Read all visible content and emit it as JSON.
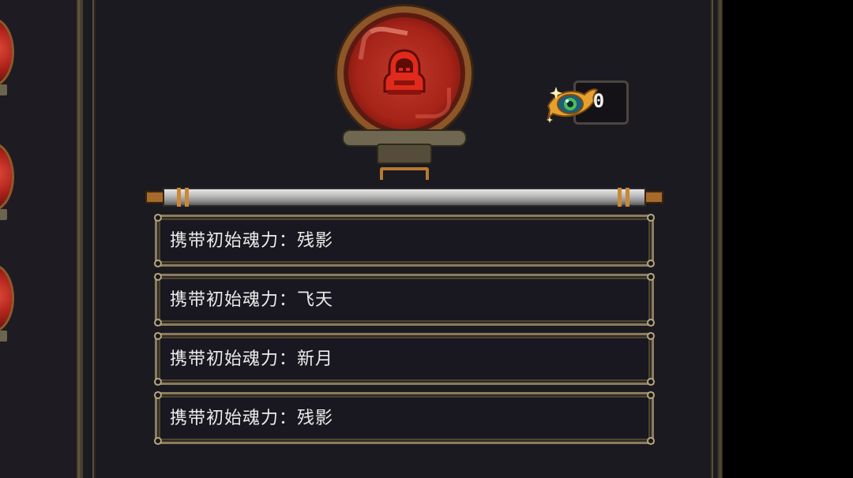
{
  "currency": {
    "count": "0",
    "icon": "ornate-eye-gem-icon"
  },
  "portrait": {
    "icon": "hooded-figure-icon",
    "orb_color": "#c0392b",
    "rim_color": "#8c5628"
  },
  "entries": [
    {
      "label": "携带初始魂力：残影"
    },
    {
      "label": "携带初始魂力：飞天"
    },
    {
      "label": "携带初始魂力：新月"
    },
    {
      "label": "携带初始魂力：残影"
    }
  ],
  "colors": {
    "panel_bg": "#1c1a21",
    "entry_border": "#8a7c5e",
    "text": "#ececec"
  }
}
